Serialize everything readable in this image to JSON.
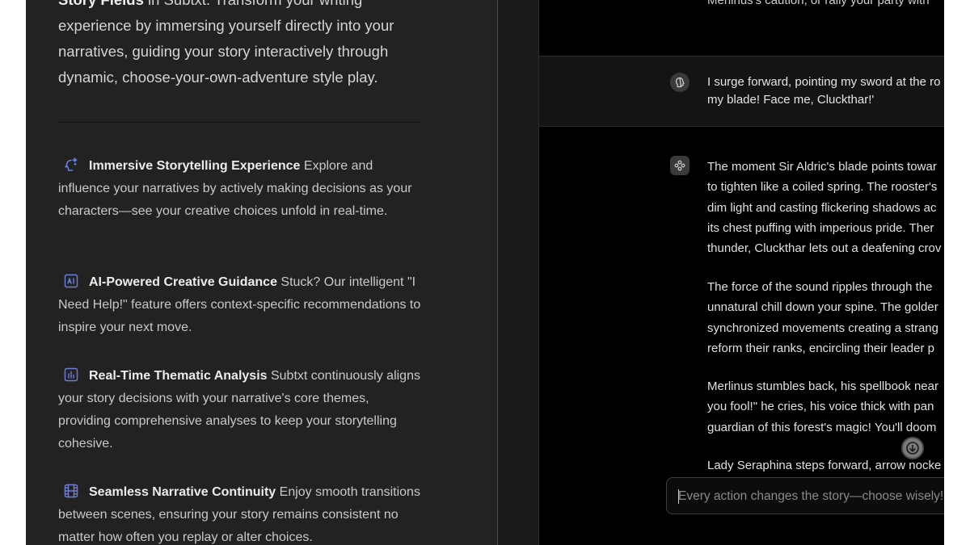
{
  "left": {
    "intro": {
      "bold_prefix": "Story Fields",
      "text": " in Subtxt. Transform your writing experience by immersing yourself directly into your narratives, guiding your story interactively through dynamic, choose-your-own-adventure style play."
    },
    "features": [
      {
        "icon": "sparkle-head-icon",
        "title": "Immersive Storytelling Experience",
        "text": " Explore and influence your narratives by actively making decisions as your characters—see your creative choices unfold in real-time."
      },
      {
        "icon": "ai-badge-icon",
        "title": "AI-Powered Creative Guidance",
        "text": " Stuck? Our intelligent \"I Need Help!\" feature offers context-specific recommendations to inspire your next move."
      },
      {
        "icon": "bar-chart-icon",
        "title": "Real-Time Thematic Analysis",
        "text": " Subtxt continuously aligns your story decisions with your narrative's core themes, providing comprehensive analyses to keep your storytelling cohesive."
      },
      {
        "icon": "film-strip-icon",
        "title": "Seamless Narrative Continuity",
        "text": " Enjoy smooth transitions between scenes, ensuring your story remains consistent no matter how often you replay or alter choices."
      }
    ]
  },
  "chat": {
    "top_fragment": "Merlinus's caution, or rally your party with",
    "user_message": {
      "avatar_icon": "head-profile-icon",
      "lines": [
        "I surge forward, pointing my sword at the ro",
        "my blade! Face me, Cluckthar!'"
      ]
    },
    "ai_message": {
      "avatar_icon": "game-controller-icon",
      "paragraphs": [
        [
          "The moment Sir Aldric's blade points towar",
          "to tighten like a coiled spring. The rooster's",
          "dim light and casting flickering shadows ac",
          "its chest puffing with imperious pride. Ther",
          "thunder, Cluckthar lets out a deafening crov"
        ],
        [
          "The force of the sound ripples through the",
          "unnatural chill down your spine. The golder",
          "synchronized movements creating a strang",
          "reform their ranks, encircling their leader p"
        ],
        [
          "Merlinus stumbles back, his spellbook near",
          "you fool!\" he cries, his voice thick with pan",
          "guardian of this forest's magic! You'll doom"
        ],
        [
          "Lady Seraphina steps forward, arrow nocke"
        ]
      ]
    },
    "scroll_button_icon": "arrow-down-circle-icon",
    "input": {
      "placeholder": "Every action changes the story—choose wisely!",
      "value": ""
    }
  }
}
